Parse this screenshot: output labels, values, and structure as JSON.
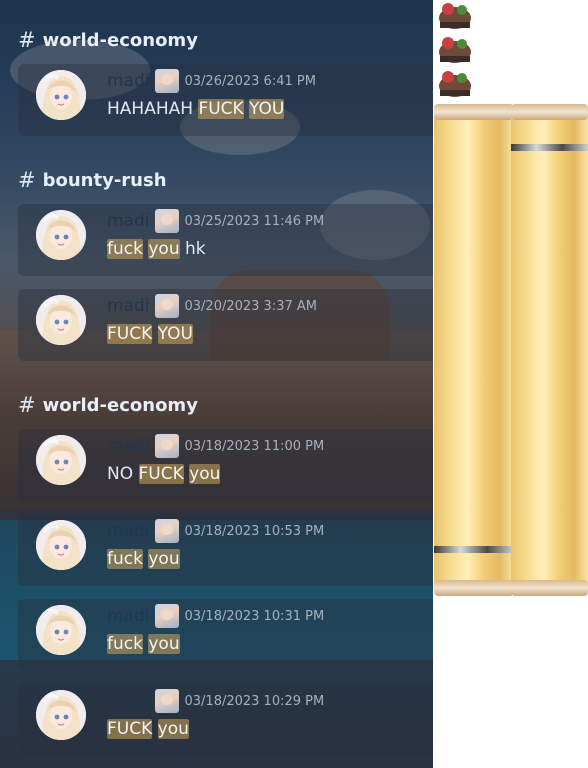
{
  "results": [
    {
      "channel": "world-economy",
      "author": "madi",
      "timestamp": "03/26/2023 6:41 PM",
      "parts": [
        {
          "text": "HAHAHAH ",
          "hl": false
        },
        {
          "text": "FUCK",
          "hl": true
        },
        {
          "text": " ",
          "hl": false
        },
        {
          "text": "YOU",
          "hl": true
        }
      ]
    },
    {
      "channel": "bounty-rush",
      "author": "madi",
      "timestamp": "03/25/2023 11:46 PM",
      "parts": [
        {
          "text": "fuck",
          "hl": true
        },
        {
          "text": " ",
          "hl": false
        },
        {
          "text": "you",
          "hl": true
        },
        {
          "text": " hk",
          "hl": false
        }
      ]
    },
    {
      "author": "madi",
      "timestamp": "03/20/2023 3:37 AM",
      "parts": [
        {
          "text": "FUCK",
          "hl": true
        },
        {
          "text": " ",
          "hl": false
        },
        {
          "text": "YOU",
          "hl": true
        }
      ]
    },
    {
      "channel": "world-economy",
      "author": "madi",
      "timestamp": "03/18/2023 11:00 PM",
      "parts": [
        {
          "text": "NO ",
          "hl": false
        },
        {
          "text": "FUCK",
          "hl": true
        },
        {
          "text": " ",
          "hl": false
        },
        {
          "text": "you",
          "hl": true
        }
      ]
    },
    {
      "author": "madi",
      "timestamp": "03/18/2023 10:53 PM",
      "parts": [
        {
          "text": "fuck",
          "hl": true
        },
        {
          "text": " ",
          "hl": false
        },
        {
          "text": "you",
          "hl": true
        }
      ]
    },
    {
      "author": "madi",
      "timestamp": "03/18/2023 10:31 PM",
      "parts": [
        {
          "text": "fuck",
          "hl": true
        },
        {
          "text": " ",
          "hl": false
        },
        {
          "text": "you",
          "hl": true
        }
      ]
    },
    {
      "author": "madi",
      "timestamp": "03/18/2023 10:29 PM",
      "parts": [
        {
          "text": "FUCK",
          "hl": true
        },
        {
          "text": " ",
          "hl": false
        },
        {
          "text": "you",
          "hl": true
        }
      ]
    }
  ],
  "header": {
    "hash_symbol": "#"
  },
  "icons": {
    "channel": "hash-icon",
    "avatar": "anime-girl-avatar",
    "role": "role-icon",
    "stickers": "toad-sticker-icon",
    "side_image": "spaghetti-jars-image"
  },
  "colors": {
    "highlight": "#d6aa5a",
    "author": "#23364f",
    "timestamp": "#a7b1bd",
    "message": "#e2e8f2"
  }
}
